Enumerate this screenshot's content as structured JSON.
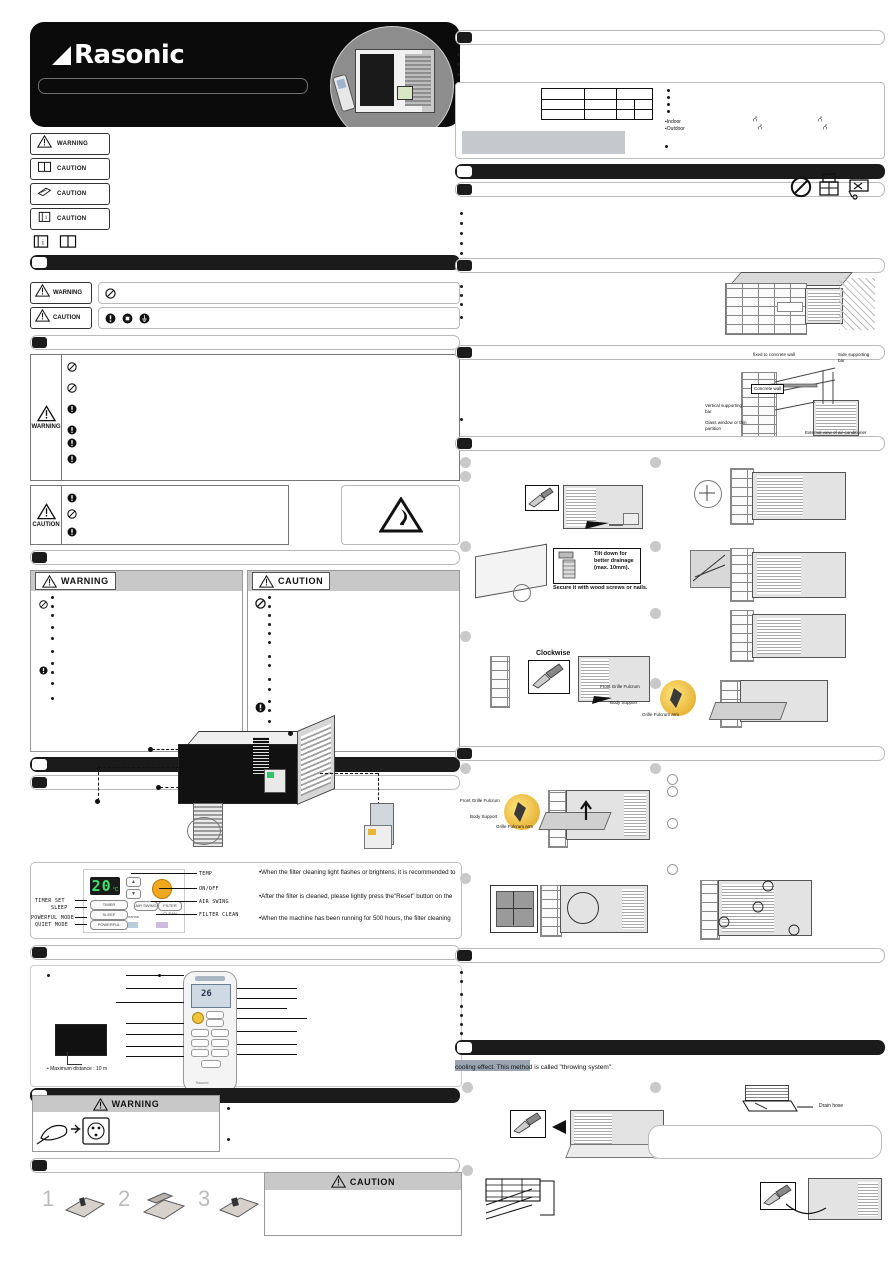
{
  "document": {
    "kind": "air-conditioner-operating-and-installation-manual-scan",
    "brand": "Rasonic"
  },
  "header": {
    "logo_text": "Rasonic",
    "hero_alt_labels": {
      "unit": "window-type room air conditioner",
      "remote": "wireless remote control"
    }
  },
  "symbol_chips": [
    {
      "icon": "warning-triangle-icon",
      "label": "WARNING"
    },
    {
      "icon": "open-book-icon",
      "label": "CAUTION"
    },
    {
      "icon": "booklet-icon",
      "label": "CAUTION"
    },
    {
      "icon": "info-book-icon",
      "label": "CAUTION"
    }
  ],
  "book_icons": [
    "info-book-icon",
    "open-book-icon"
  ],
  "bars": {
    "safety_precautions": "",
    "symbol_legend": "",
    "warning_caution_table": "",
    "two_column_notices": "",
    "product_overview": "",
    "remote_section": "",
    "battery_section": "",
    "right_specs": "",
    "right_accessories": "",
    "right_install_location": "",
    "right_wall_fixing": "",
    "right_install_steps": "",
    "right_front_grille": "",
    "right_checklist": "",
    "right_operation": "",
    "right_drain": ""
  },
  "legend": {
    "warning_label": "WARNING",
    "caution_label": "CAUTION",
    "prohibit_icon": "prohibition-icon",
    "mandatory_icons": [
      "mandatory-icon",
      "unplug-icon",
      "ground-icon"
    ]
  },
  "warning_table": {
    "warning_label": "WARNING",
    "caution_label": "CAUTION",
    "warning_marks": [
      "prohibition-icon",
      "prohibition-icon",
      "mandatory-icon",
      "mandatory-icon",
      "mandatory-icon",
      "mandatory-icon"
    ],
    "caution_marks": [
      "mandatory-icon",
      "prohibition-icon",
      "mandatory-icon"
    ],
    "fire_icon": "flammable-warning-icon"
  },
  "notices": {
    "left": {
      "title": "WARNING",
      "icon": "warning-triangle-icon",
      "marks": [
        "prohibition-icon",
        "mandatory-icon"
      ],
      "line_count": 12
    },
    "right": {
      "title": "CAUTION",
      "icon": "warning-triangle-icon",
      "marks": [
        "prohibition-icon",
        "mandatory-icon"
      ],
      "line_count": 14
    }
  },
  "control_panel": {
    "display_value": "20",
    "display_unit": "°C",
    "left_labels": [
      "TIMER SET",
      "SLEEP",
      "POWERFUL MODE",
      "QUIET MODE"
    ],
    "right_labels": [
      "TEMP",
      "ON/OFF",
      "AIR SWING",
      "FILTER CLEAN"
    ],
    "buttons": {
      "up": "▲",
      "down": "▼",
      "power": "POWER ON/OFF",
      "air_swing": "AIR SWING",
      "filter_clean": "FILTER CLEAN",
      "timer": "TIMER",
      "sleep": "SLEEP",
      "powerful": "POWERFUL",
      "quiet": "QUIET"
    },
    "logo_line": "nanoe",
    "bottom_icons": [
      "ion-icon",
      "powerful-icon"
    ],
    "notes": [
      "•When the filter cleaning light flashes or brightens, it is recommended to",
      "•After the filter is cleaned, please lightly press the\"Reset\" button on the",
      "•When the machine has been running for 500 hours, the filter cleaning"
    ]
  },
  "remote": {
    "display_value": "26",
    "max_distance_note": "• Maximum distance : 10 m",
    "brand": "Rasonic"
  },
  "battery": {
    "warning_title": "WARNING",
    "warning_icon": "warning-triangle-icon",
    "plug_icon": "plug-and-socket-icon",
    "steps": [
      "1",
      "2",
      "3"
    ],
    "caution_title": "CAUTION",
    "caution_icon": "warning-triangle-icon"
  },
  "specs": {
    "table_rows": 3,
    "table_cols": 4,
    "bullet_labels": [
      "Indoor",
      "Outdoor"
    ],
    "unit_marks": [
      "°C",
      "°C",
      "°C",
      "°C"
    ]
  },
  "accessories": {
    "icons": [
      "prohibition-icon",
      "no-stacking-icon",
      "no-handcart-icon"
    ]
  },
  "install_location": {
    "diagram": "wall-opening-and-ledge-illustration"
  },
  "wall_fixing": {
    "labels": [
      "fixed to concrete wall",
      "Side supporting bar",
      "Concrete wall",
      "Vertical supporting bar",
      "Glass window or thin partition",
      "External view of air-conditioner installation"
    ]
  },
  "install_steps": {
    "drain_callout": "Tilt down for better drainage (max. 10mm).",
    "drain_note": "Secure it with wood screws or nails.",
    "clockwise_label": "Clockwise",
    "grille_labels": [
      "Front Grille Fulcrum",
      "Body Support",
      "Grille Fulcrum arm"
    ]
  },
  "operation": {
    "throwing_system_text": "cooling effect. This method is called \"throwing system\".",
    "drain_hose_label": "Drain hose"
  }
}
